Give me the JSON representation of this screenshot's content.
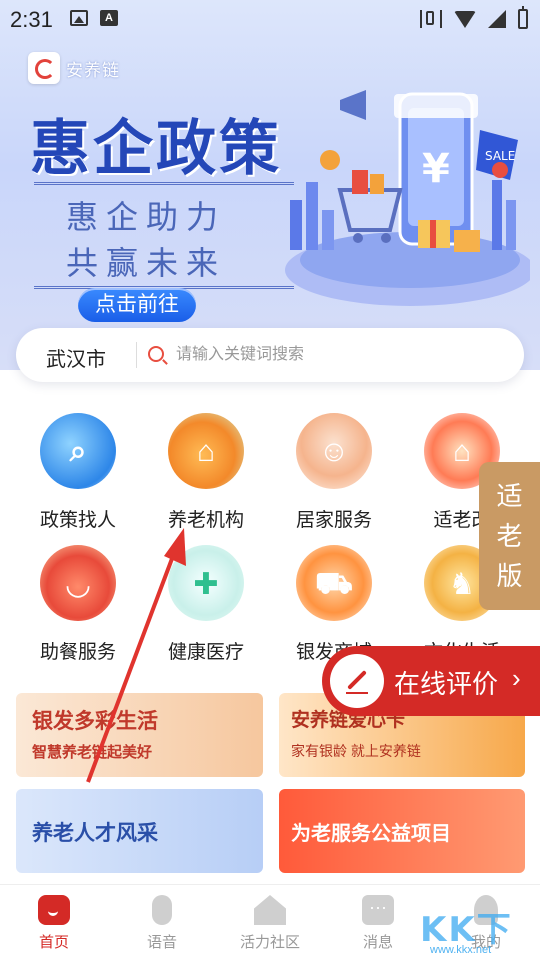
{
  "status_bar": {
    "time": "2:31"
  },
  "banner": {
    "logo_text": "安养链",
    "title": "惠企政策",
    "subtitle_line1": "惠企助力",
    "subtitle_line2": "共赢未来",
    "cta": "点击前往"
  },
  "search": {
    "city": "武汉市",
    "placeholder": "请输入关键词搜索"
  },
  "grid": [
    {
      "label": "政策找人",
      "icon": "document-search-icon"
    },
    {
      "label": "养老机构",
      "icon": "house-icon"
    },
    {
      "label": "居家服务",
      "icon": "caregiver-icon"
    },
    {
      "label": "适老改",
      "icon": "home-renovation-icon"
    },
    {
      "label": "助餐服务",
      "icon": "meal-bowl-icon"
    },
    {
      "label": "健康医疗",
      "icon": "medical-kit-icon"
    },
    {
      "label": "银发商城",
      "icon": "shopping-cart-icon"
    },
    {
      "label": "文化生活",
      "icon": "chess-icon"
    }
  ],
  "side_badge": {
    "line1": "适",
    "line2": "老",
    "line3": "版"
  },
  "review_button": {
    "label": "在线评价",
    "chevron": "›"
  },
  "cards": {
    "card1": {
      "title": "银发多彩生活",
      "subtitle": "智慧养老链起美好"
    },
    "card2": {
      "title": "安养链爱心卡",
      "subtitle": "家有银龄 就上安养链"
    },
    "card3": {
      "title": "养老人才风采"
    },
    "card4": {
      "title": "为老服务公益项目"
    }
  },
  "tabbar": [
    {
      "label": "首页",
      "icon": "home-icon",
      "active": true
    },
    {
      "label": "语音",
      "icon": "microphone-icon",
      "active": false
    },
    {
      "label": "活力社区",
      "icon": "community-icon",
      "active": false
    },
    {
      "label": "消息",
      "icon": "message-icon",
      "active": false
    },
    {
      "label": "我的",
      "icon": "user-icon",
      "active": false
    }
  ],
  "watermark": {
    "text": "KK下载",
    "url": "www.kkx.net"
  },
  "colors": {
    "primary_red": "#d42a26",
    "banner_blue": "#2447b8",
    "badge_gold": "#c99a64"
  }
}
